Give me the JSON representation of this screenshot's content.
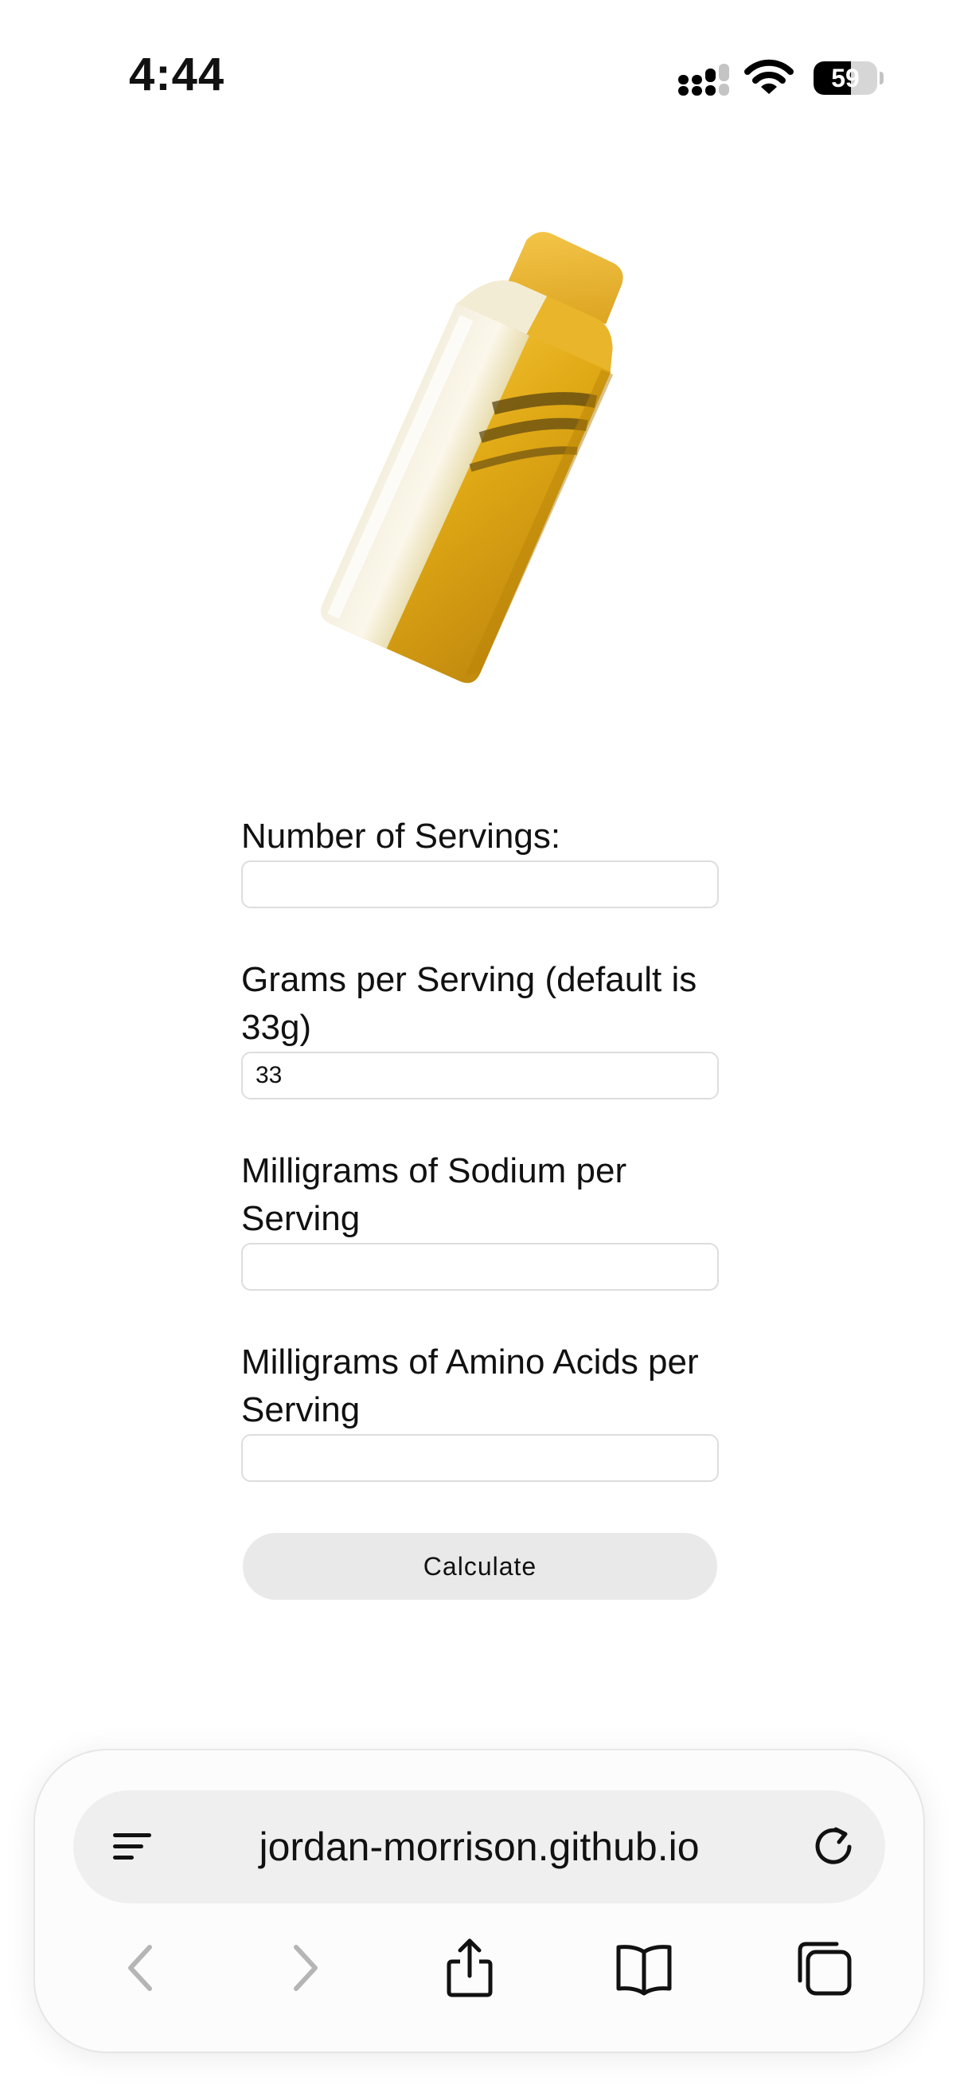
{
  "status_bar": {
    "time": "4:44",
    "battery_level": "59",
    "battery_fraction": 0.59
  },
  "product_image": {
    "icon": "energy-gel-packet",
    "colors": {
      "gold": "#d9a21c",
      "gold_light": "#f3c84a",
      "clear": "#f1ecd8"
    }
  },
  "form": {
    "fields": [
      {
        "label": "Number of Servings:",
        "value": "",
        "placeholder": ""
      },
      {
        "label": "Grams per Serving (default is 33g)",
        "value": "33",
        "placeholder": ""
      },
      {
        "label": "Milligrams of Sodium per Serving",
        "value": "",
        "placeholder": ""
      },
      {
        "label": "Milligrams of Amino Acids per Serving",
        "value": "",
        "placeholder": ""
      }
    ],
    "calculate_label": "Calculate"
  },
  "browser": {
    "url": "jordan-morrison.github.io",
    "icons": {
      "menu": "menu-lines-icon",
      "reload": "reload-icon",
      "back": "chevron-left-icon",
      "forward": "chevron-right-icon",
      "share": "share-icon",
      "bookmarks": "book-icon",
      "tabs": "tabs-icon"
    },
    "back_enabled": false,
    "forward_enabled": false
  }
}
